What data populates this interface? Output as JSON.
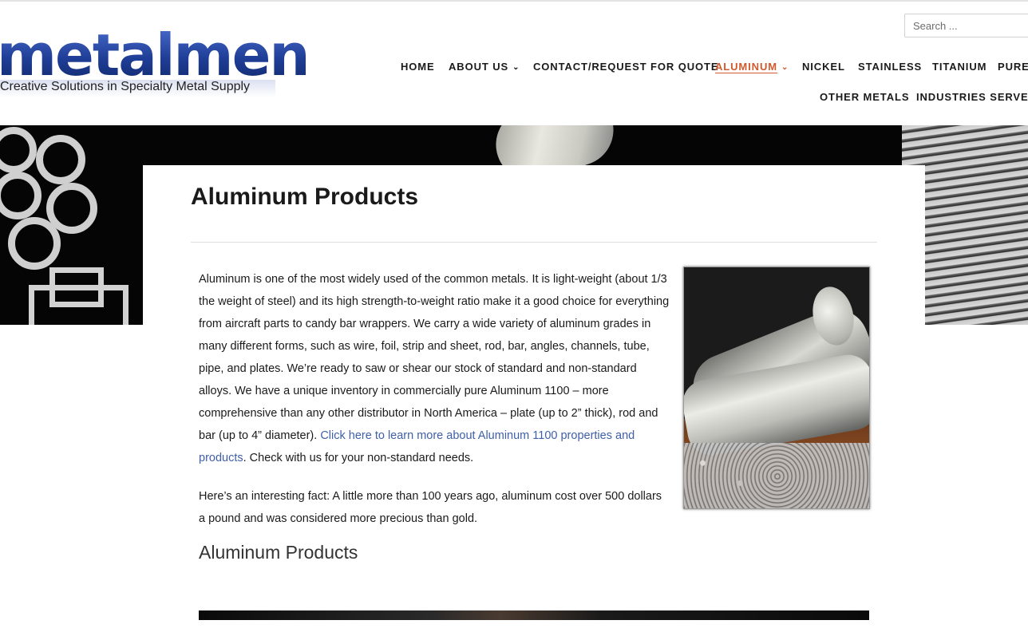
{
  "header": {
    "logo_word": "metalmen",
    "tagline": "Creative Solutions in Specialty Metal Supply",
    "search_placeholder": "Search ..."
  },
  "nav": {
    "row1": [
      {
        "label": "HOME"
      },
      {
        "label": "ABOUT US",
        "has_dropdown": true
      },
      {
        "label": "CONTACT/REQUEST FOR QUOTE"
      },
      {
        "label": "ALUMINUM",
        "has_dropdown": true,
        "active": true
      },
      {
        "label": "NICKEL"
      },
      {
        "label": "STAINLESS"
      },
      {
        "label": "TITANIUM"
      },
      {
        "label": "PURE"
      }
    ],
    "row2": [
      {
        "label": "OTHER METALS"
      },
      {
        "label": "INDUSTRIES SERVED"
      }
    ],
    "active_color": "#d15a2c"
  },
  "content": {
    "title": "Aluminum Products",
    "p1_text": "Aluminum is one of the most widely used of the common metals. It is light-weight (about 1/3 the weight of steel) and its high strength-to-weight ratio make it a good choice for everything from aircraft parts to candy bar wrappers. We carry a wide variety of aluminum grades in many different forms, such as wire, foil, strip and sheet, rod, bar, angles, channels, tube, pipe, and plates.  We’re ready to saw or shear our stock of standard and non-standard alloys.  We have a unique inventory in commercially pure Aluminum 1100 – more comprehensive than any other distributor in North America – plate (up to 2” thick), rod and bar (up to 4” diameter).   ",
    "p1_link": "Click here to learn more about Aluminum 1100 properties and products",
    "p1_tail": ". Check with us for your non-standard needs.",
    "p2_text": "Here’s an interesting fact:  A little more than 100 years ago, aluminum cost over 500 dollars a pound and was considered more precious than gold.",
    "subheading": "Aluminum Products"
  },
  "colors": {
    "logo_blue": "#1f3f8f",
    "link_blue": "#3f5fa8",
    "nav_active": "#d15a2c"
  }
}
